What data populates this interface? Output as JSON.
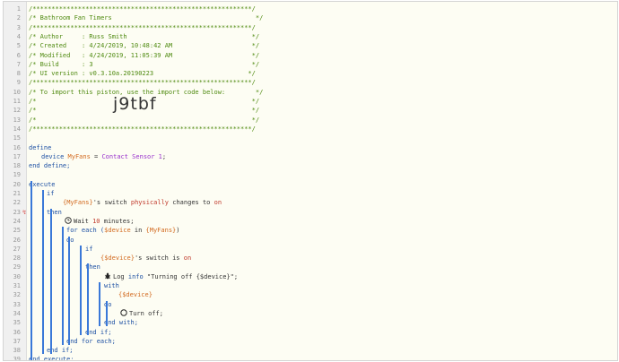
{
  "line_numbers": [
    "1",
    "2",
    "3",
    "4",
    "5",
    "6",
    "7",
    "8",
    "9",
    "10",
    "11",
    "12",
    "13",
    "14",
    "15",
    "16",
    "17",
    "18",
    "19",
    "20",
    "21",
    "22",
    "23",
    "24",
    "25",
    "26",
    "27",
    "28",
    "29",
    "30",
    "31",
    "32",
    "33",
    "34",
    "35",
    "36",
    "37",
    "38",
    "39"
  ],
  "header": {
    "border": "/**********************************************************/",
    "title": "/* Bathroom Fan Timers                                      */",
    "author": "/* Author     : Russ Smith                                 */",
    "created": "/* Created    : 4/24/2019, 10:48:42 AM                     */",
    "modified": "/* Modified   : 4/24/2019, 11:05:39 AM                     */",
    "build": "/* Build      : 3                                          */",
    "ui_version": "/* UI version : v0.3.10a.20190223                         */",
    "import_text": "/* To import this piston, use the import code below:        */",
    "blank": "/*                                                         */",
    "import_code": "j9tbf"
  },
  "code": {
    "define": "define",
    "device_kw": "device",
    "device_name": "MyFans",
    "eq": " = ",
    "contact": "Contact Sensor 1",
    "semi": ";",
    "end_define": "end define;",
    "execute": "execute",
    "if": "if",
    "myfans_ref": "{MyFans}",
    "switch_text": "'s switch ",
    "physically": "physically",
    "changes_to": " changes to ",
    "on": "on",
    "then": "then",
    "wait": "Wait ",
    "ten": "10",
    "minutes": " minutes;",
    "for_each": "for each (",
    "device_var": "$device",
    "in": " in ",
    "close_paren": ")",
    "do": "do",
    "device_ref": "{$device}",
    "switch_is": "'s switch is ",
    "log": "Log ",
    "info": "info",
    "log_msg": " \"Turning off {$device}\";",
    "with": "with",
    "turn_off": "Turn off;",
    "end_with": "end with;",
    "end_if": "end if;",
    "end_for_each": "end for each;",
    "end_execute": "end execute;"
  },
  "marker_line_23": "↯"
}
